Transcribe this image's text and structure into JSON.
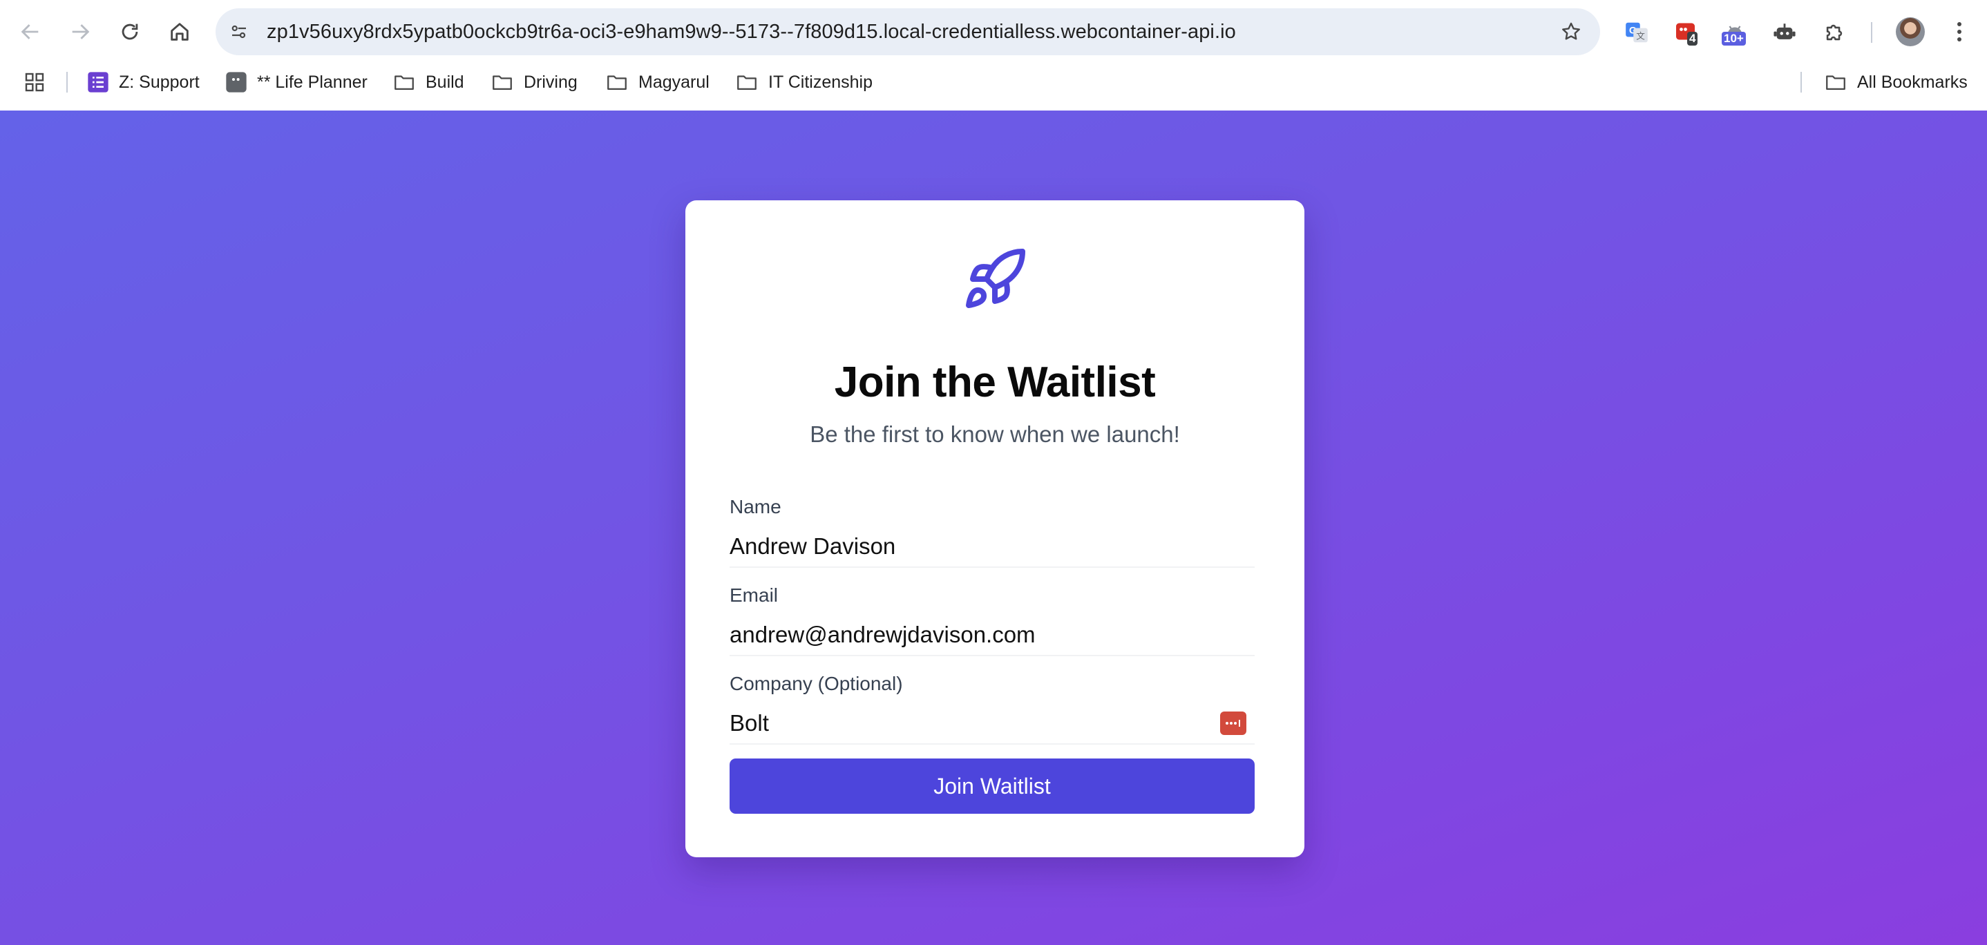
{
  "browser": {
    "url": "zp1v56uxy8rdx5ypatb0ockcb9tr6a-oci3-e9ham9w9--5173--7f809d15.local-credentialless.webcontainer-api.io",
    "extensions": {
      "badge_mail": "4",
      "badge_android": "10+"
    }
  },
  "bookmarks": {
    "items": [
      {
        "label": "Z: Support",
        "icon": "list-icon"
      },
      {
        "label": "** Life Planner",
        "icon": "bookmark-square-icon"
      },
      {
        "label": "Build",
        "icon": "folder-icon"
      },
      {
        "label": "Driving",
        "icon": "folder-icon"
      },
      {
        "label": "Magyarul",
        "icon": "folder-icon"
      },
      {
        "label": "IT Citizenship",
        "icon": "folder-icon"
      }
    ],
    "all_bookmarks": "All Bookmarks"
  },
  "card": {
    "icon": "rocket-icon",
    "title": "Join the Waitlist",
    "subtitle": "Be the first to know when we launch!",
    "fields": [
      {
        "label": "Name",
        "value": "Andrew Davison"
      },
      {
        "label": "Email",
        "value": "andrew@andrewjdavison.com"
      },
      {
        "label": "Company (Optional)",
        "value": "Bolt"
      }
    ],
    "submit_label": "Join Waitlist"
  },
  "colors": {
    "accent": "#4d45dc",
    "gradient_start": "#6462e8",
    "gradient_end": "#8a3edf"
  }
}
